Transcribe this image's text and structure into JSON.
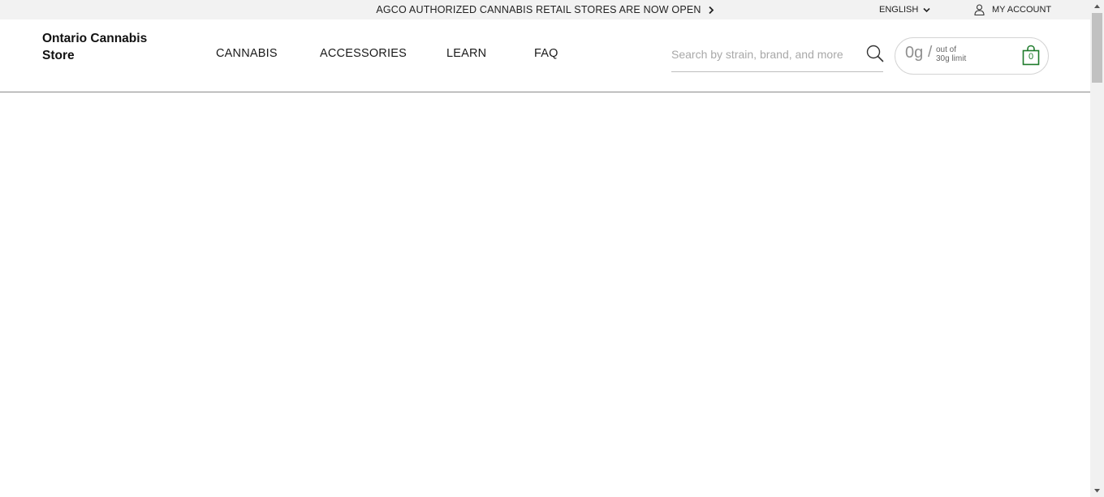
{
  "topbar": {
    "announcement": "AGCO AUTHORIZED CANNABIS RETAIL STORES ARE NOW OPEN",
    "language": "ENGLISH",
    "account": "MY ACCOUNT"
  },
  "header": {
    "logo_line1": "Ontario Cannabis",
    "logo_line2": "Store",
    "nav": [
      "CANNABIS",
      "ACCESSORIES",
      "LEARN",
      "FAQ"
    ]
  },
  "search": {
    "placeholder": "Search by strain, brand, and more",
    "value": ""
  },
  "cart": {
    "grams": "0g",
    "slash": "/",
    "limit_line1": "out of",
    "limit_line2": "30g limit",
    "item_count": "0"
  },
  "colors": {
    "accent_green": "#1d7a2a",
    "topbar_bg": "#f2f2f2"
  },
  "icons": {
    "announcement_arrow": "chevron-right-icon",
    "language_dropdown": "chevron-down-icon",
    "account": "user-icon",
    "search": "search-icon",
    "cart": "shopping-bag-icon"
  }
}
